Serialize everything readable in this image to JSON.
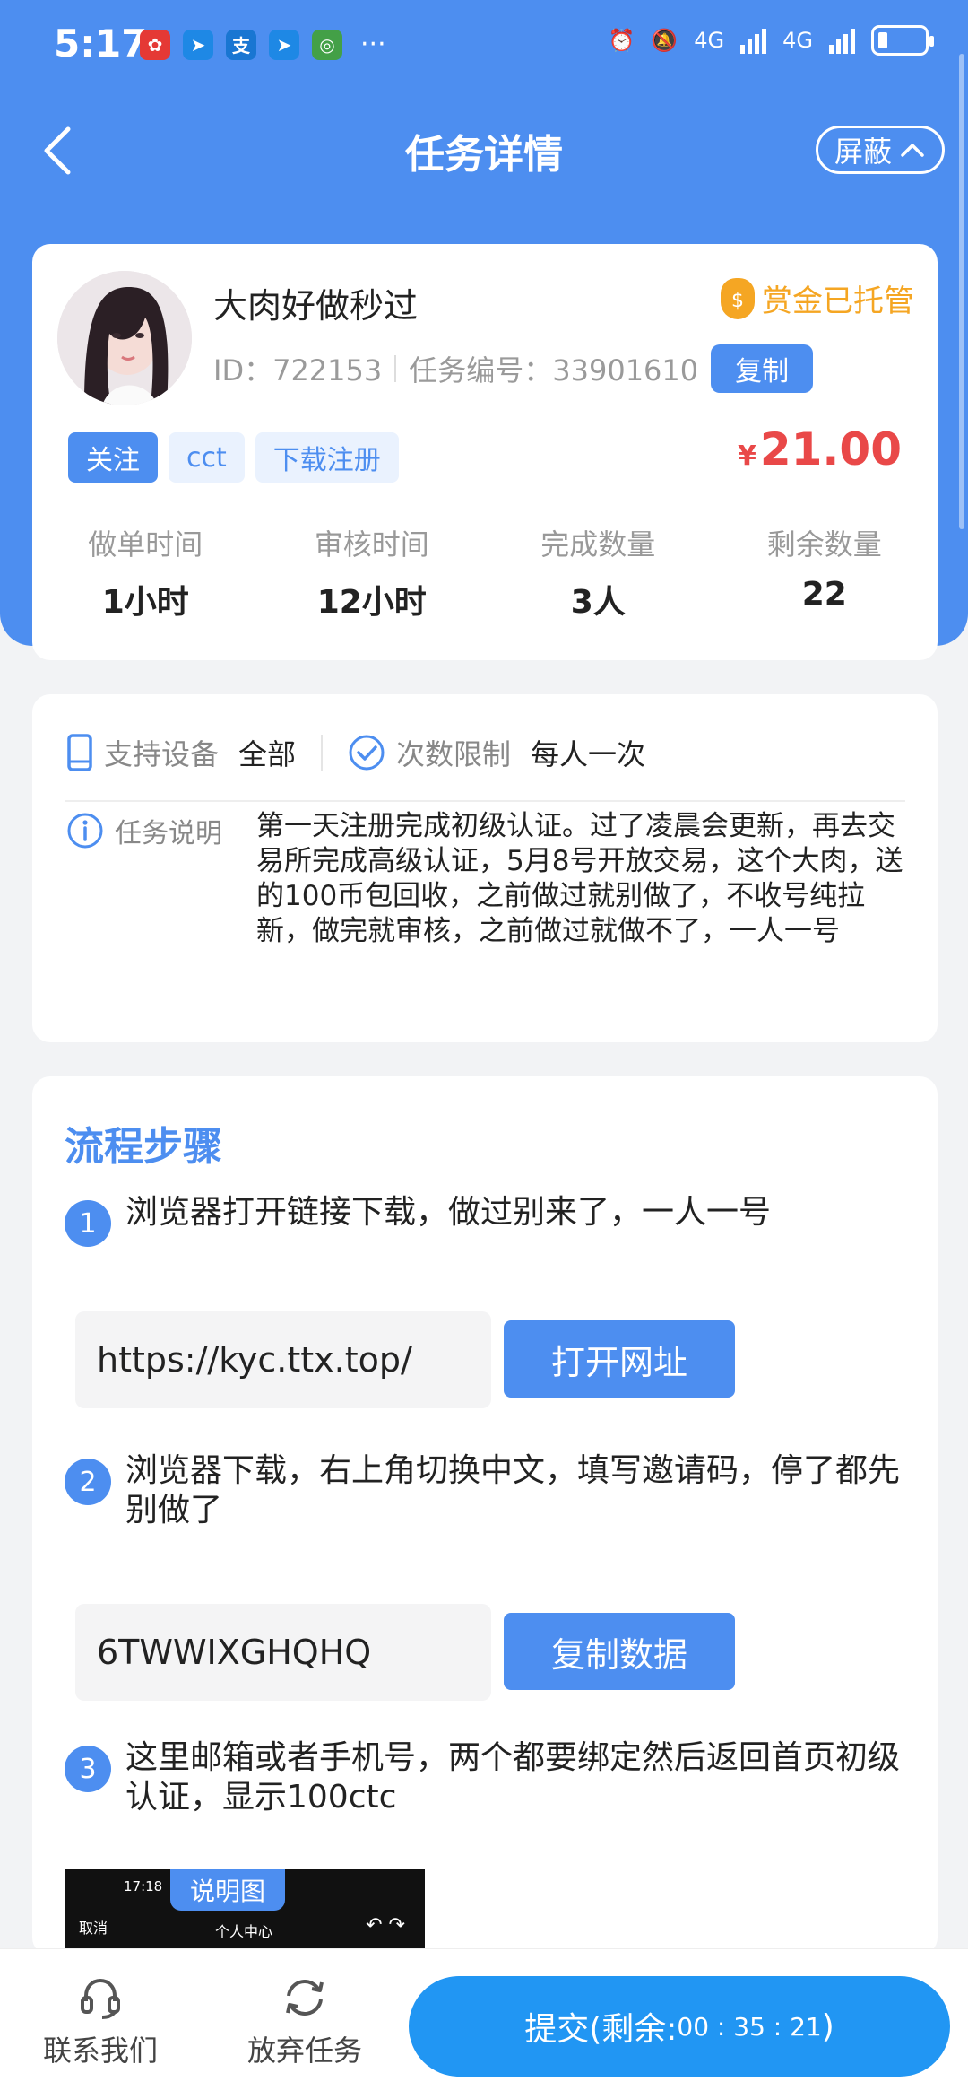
{
  "status_bar": {
    "time": "5:17",
    "more": "···",
    "network": [
      "4G",
      "4G"
    ]
  },
  "nav": {
    "title": "任务详情",
    "shield_label": "屏蔽"
  },
  "task": {
    "name": "大肉好做秒过",
    "bounty_label": "赏金已托管",
    "id_text": "ID：722153",
    "number_text": "任务编号：33901610",
    "copy_label": "复制",
    "tags": [
      "关注",
      "cct",
      "下载注册"
    ],
    "currency": "¥",
    "price": "21.00",
    "stats": [
      {
        "label": "做单时间",
        "value": "1小时"
      },
      {
        "label": "审核时间",
        "value": "12小时"
      },
      {
        "label": "完成数量",
        "value": "3人"
      },
      {
        "label": "剩余数量",
        "value": "22"
      }
    ]
  },
  "info": {
    "device_label": "支持设备",
    "device_value": "全部",
    "limit_label": "次数限制",
    "limit_value": "每人一次",
    "desc_label": "任务说明",
    "desc_text": "第一天注册完成初级认证。过了凌晨会更新，再去交易所完成高级认证，5月8号开放交易，这个大肉，送的100币包回收，之前做过就别做了，不收号纯拉新，做完就审核，之前做过就做不了，一人一号"
  },
  "steps": {
    "title": "流程步骤",
    "items": [
      {
        "num": "1",
        "text": "浏览器打开链接下载，做过别来了，一人一号",
        "field": "https://kyc.ttx.top/",
        "button": "打开网址"
      },
      {
        "num": "2",
        "text": "浏览器下载，右上角切换中文，填写邀请码，停了都先别做了",
        "field": "6TWWIXGHQHQ",
        "button": "复制数据"
      },
      {
        "num": "3",
        "text": "这里邮箱或者手机号，两个都要绑定然后返回首页初级认证，显示100ctc"
      }
    ],
    "preview": {
      "label": "说明图",
      "time": "17:18",
      "cancel": "取消",
      "center": "个人中心"
    }
  },
  "bottom": {
    "contact": "联系我们",
    "abandon": "放弃任务",
    "submit_prefix": "提交(剩余:",
    "timer": "00 : 35 : 21",
    "submit_suffix": ")"
  },
  "colors": {
    "primary": "#4d8ef0",
    "price": "#e94848",
    "bounty": "#f5a623",
    "submit": "#2196f3"
  }
}
